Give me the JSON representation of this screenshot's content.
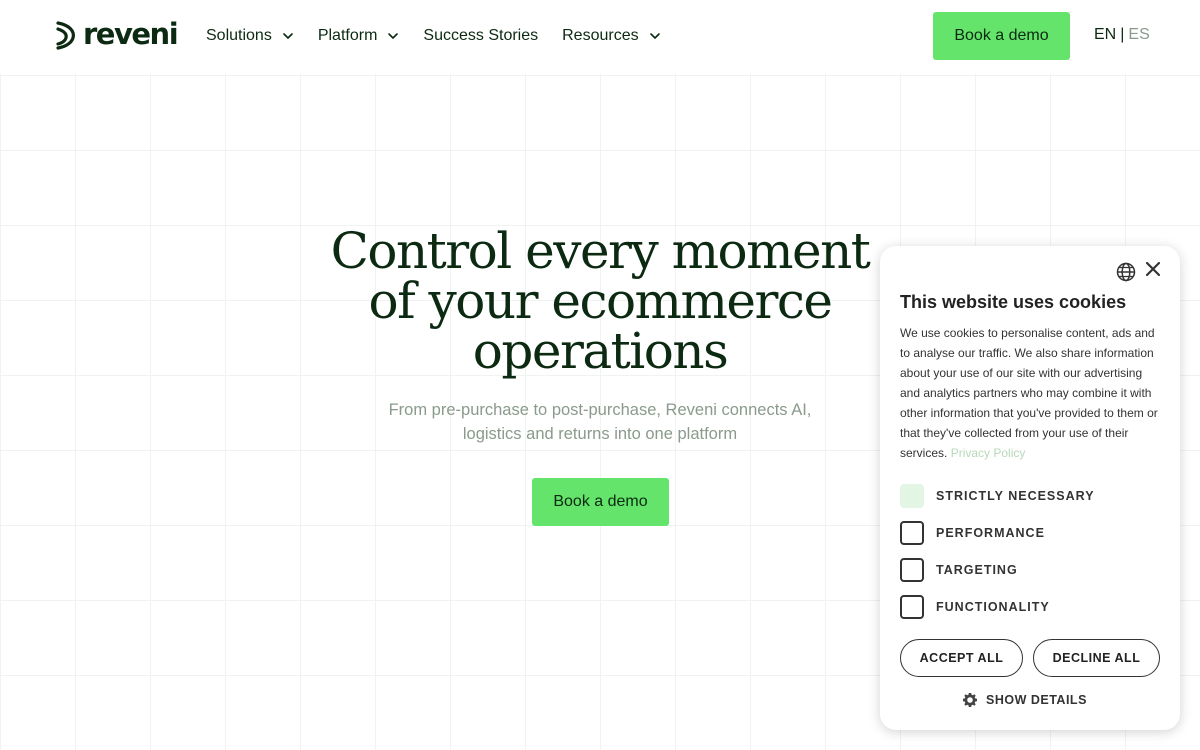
{
  "brand": {
    "logo_text": "reveni",
    "accent_color": "#64e46a",
    "text_color": "#0c2a12"
  },
  "nav": {
    "items": [
      {
        "label": "Solutions",
        "has_dropdown": true
      },
      {
        "label": "Platform",
        "has_dropdown": true
      },
      {
        "label": "Success Stories",
        "has_dropdown": false
      },
      {
        "label": "Resources",
        "has_dropdown": true
      }
    ],
    "demo_button": "Book a demo",
    "lang_active": "EN",
    "lang_separator": "|",
    "lang_other": "ES"
  },
  "hero": {
    "title_line_1": "Control every moment",
    "title_line_2": "of your ecommerce",
    "title_line_3": "operations",
    "subtitle_line_1": "From pre-purchase to post-purchase, Reveni connects AI,",
    "subtitle_line_2": "logistics and returns into one platform",
    "cta": "Book a demo"
  },
  "cookie": {
    "title": "This website uses cookies",
    "body": "We use cookies to personalise content, ads and to analyse our traffic. We also share information about your use of our site with our advertising and analytics partners who may combine it with other information that you've provided to them or that they've collected from your use of their services.",
    "policy_link": "Privacy Policy",
    "options": [
      {
        "label": "STRICTLY NECESSARY",
        "checked": true
      },
      {
        "label": "PERFORMANCE",
        "checked": false
      },
      {
        "label": "TARGETING",
        "checked": false
      },
      {
        "label": "FUNCTIONALITY",
        "checked": false
      }
    ],
    "accept_all": "ACCEPT ALL",
    "decline_all": "DECLINE ALL",
    "show_details": "SHOW DETAILS",
    "icons": [
      "globe-icon",
      "close-icon",
      "gear-icon"
    ]
  }
}
